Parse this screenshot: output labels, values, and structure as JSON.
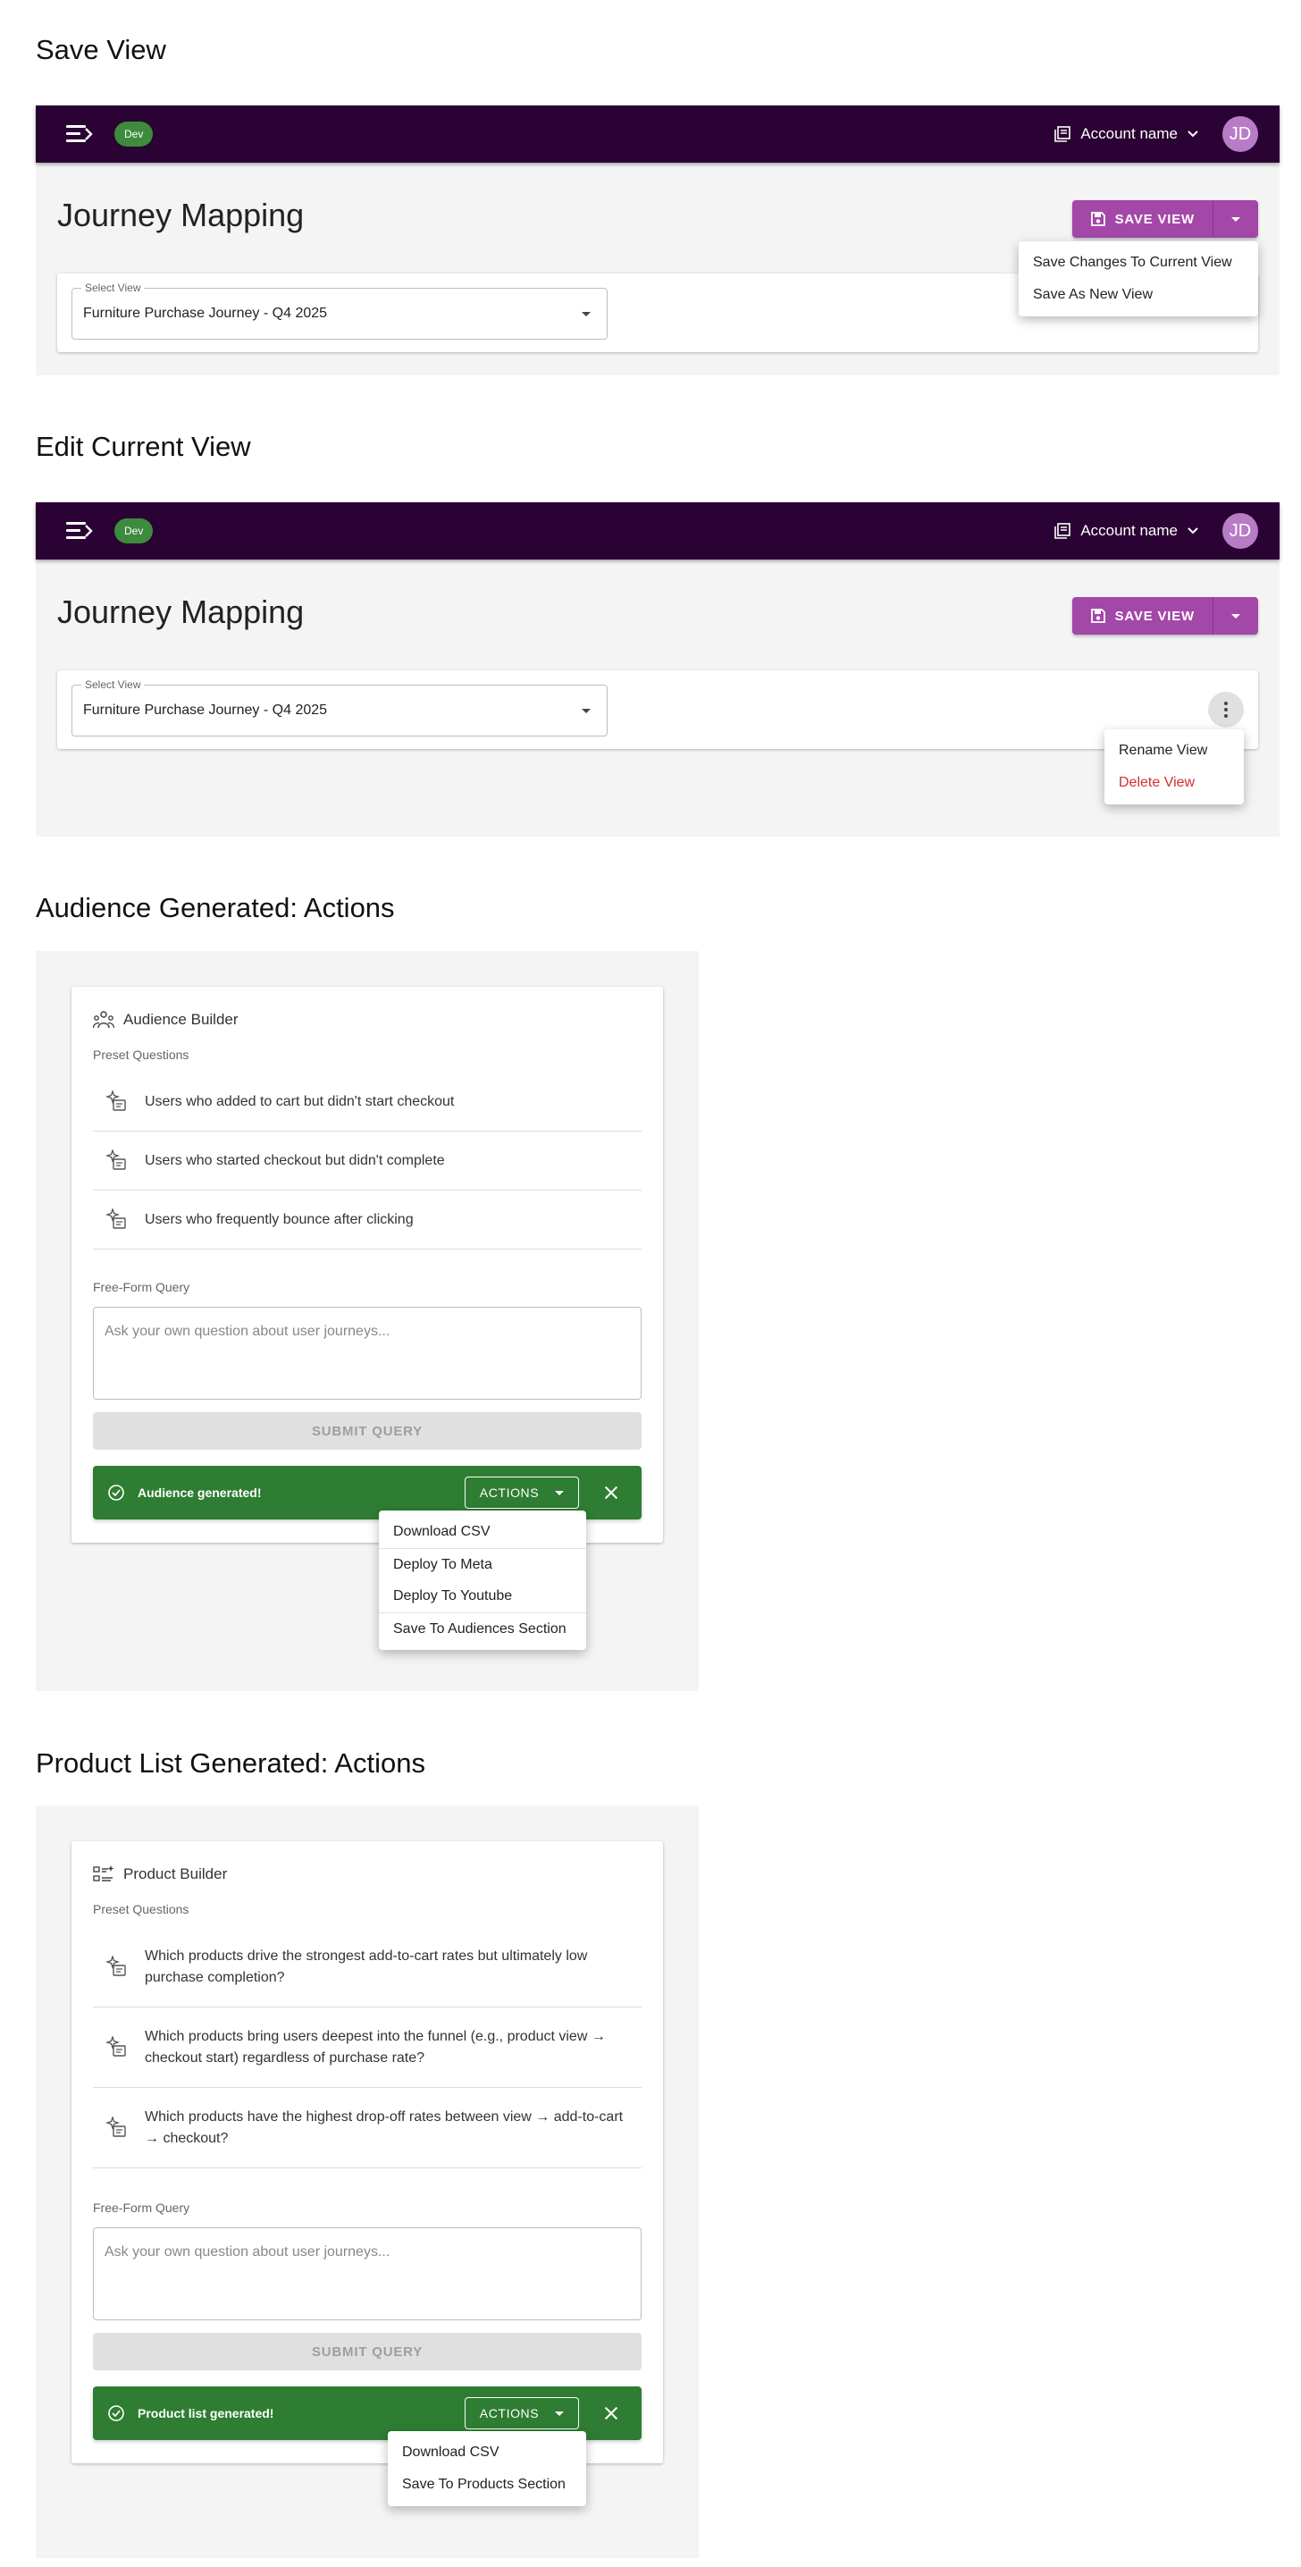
{
  "sections": {
    "save_view": "Save View",
    "edit_view": "Edit Current View",
    "audience_actions": "Audience Generated: Actions",
    "product_actions": "Product List Generated: Actions"
  },
  "appbar": {
    "env_chip": "Dev",
    "account_name": "Account name",
    "avatar_initials": "JD"
  },
  "page": {
    "title": "Journey Mapping",
    "save_button": "SAVE VIEW",
    "select_label": "Select View",
    "select_value": "Furniture Purchase Journey - Q4 2025"
  },
  "save_menu": [
    "Save Changes To Current View",
    "Save As New View"
  ],
  "edit_menu": {
    "rename": "Rename View",
    "delete": "Delete View",
    "delete_color": "#d32f2f"
  },
  "audience_builder": {
    "title": "Audience Builder",
    "preset_label": "Preset Questions",
    "questions": [
      "Users who added to cart but didn't start checkout",
      "Users who started checkout but didn't complete",
      "Users who frequently bounce after clicking"
    ],
    "freeform_label": "Free-Form Query",
    "placeholder": "Ask your own question about user journeys...",
    "submit": "SUBMIT QUERY",
    "snackbar": "Audience generated!",
    "actions": "ACTIONS",
    "menu": [
      "Download CSV",
      "Deploy To Meta",
      "Deploy To Youtube",
      "Save To Audiences Section"
    ]
  },
  "product_builder": {
    "title": "Product Builder",
    "preset_label": "Preset Questions",
    "questions": [
      "Which products drive the strongest add-to-cart rates but ultimately low purchase completion?",
      "Which products bring users deepest into the funnel (e.g., product view → checkout start) regardless of purchase rate?",
      "Which products have the highest drop-off rates between view → add-to-cart → checkout?"
    ],
    "freeform_label": "Free-Form Query",
    "placeholder": "Ask your own question about user journeys...",
    "submit": "SUBMIT QUERY",
    "snackbar": "Product list generated!",
    "actions": "ACTIONS",
    "menu": [
      "Download CSV",
      "Save To Products Section"
    ]
  },
  "colors": {
    "appbar": "#2a0233",
    "accent": "#a347a8",
    "success": "#2e7d32",
    "dev_chip": "#3d8b3d",
    "avatar": "#b87cc6"
  }
}
